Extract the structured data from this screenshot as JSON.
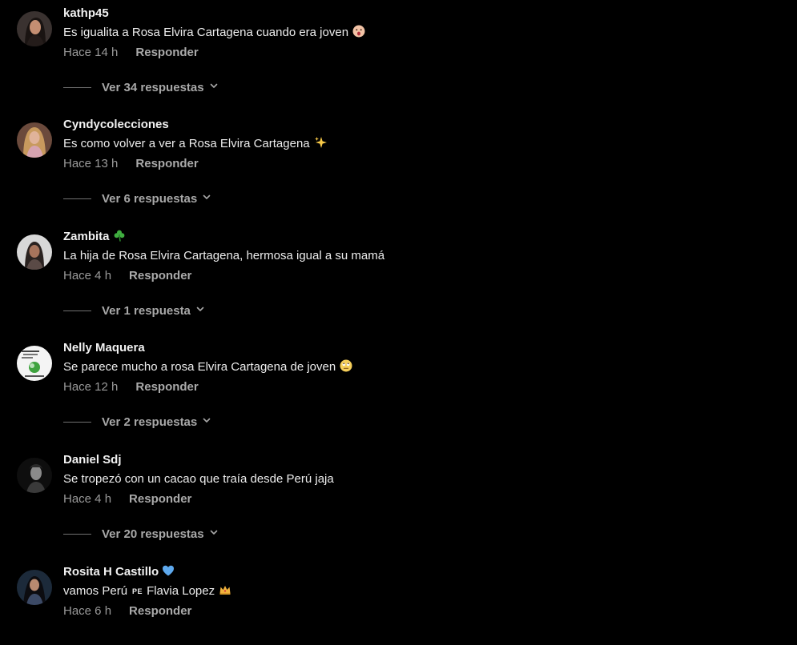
{
  "colors": {
    "background": "#000000",
    "author": "#f1f1f1",
    "text": "#ededed",
    "meta": "#9a9a9a",
    "heart_blue": "#5ea9ee",
    "shamrock_green": "#3fae3f"
  },
  "comments": [
    {
      "author": "kathp45",
      "text": "Es igualita a Rosa Elvira Cartagena cuando era joven",
      "text_emoji": "astonished-face-icon",
      "time": "Hace 14 h",
      "reply_label": "Responder",
      "replies_label": "Ver 34 respuestas"
    },
    {
      "author": "Cyndycolecciones",
      "text": "Es como volver a ver a Rosa Elvira Cartagena",
      "text_emoji": "sparkles-icon",
      "time": "Hace 13 h",
      "reply_label": "Responder",
      "replies_label": "Ver 6 respuestas"
    },
    {
      "author": "Zambita",
      "author_emoji": "shamrock-icon",
      "text": "La hija de Rosa Elvira Cartagena, hermosa igual a su mamá",
      "time": "Hace 4 h",
      "reply_label": "Responder",
      "replies_label": "Ver 1 respuesta"
    },
    {
      "author": "Nelly Maquera",
      "text": "Se parece mucho a rosa Elvira Cartagena de joven",
      "text_emoji": "face-rolling-eyes-icon",
      "time": "Hace 12 h",
      "reply_label": "Responder",
      "replies_label": "Ver 2 respuestas"
    },
    {
      "author": "Daniel Sdj",
      "text": "Se tropezó con un cacao que traía desde Perú jaja",
      "time": "Hace 4 h",
      "reply_label": "Responder",
      "replies_label": "Ver 20 respuestas"
    },
    {
      "author": "Rosita H Castillo",
      "author_emoji": "blue-heart-icon",
      "text_part1": "vamos Perú",
      "text_tag": "PE",
      "text_part2": "Flavia Lopez",
      "text_emoji": "crown-icon",
      "time": "Hace 6 h",
      "reply_label": "Responder"
    }
  ]
}
